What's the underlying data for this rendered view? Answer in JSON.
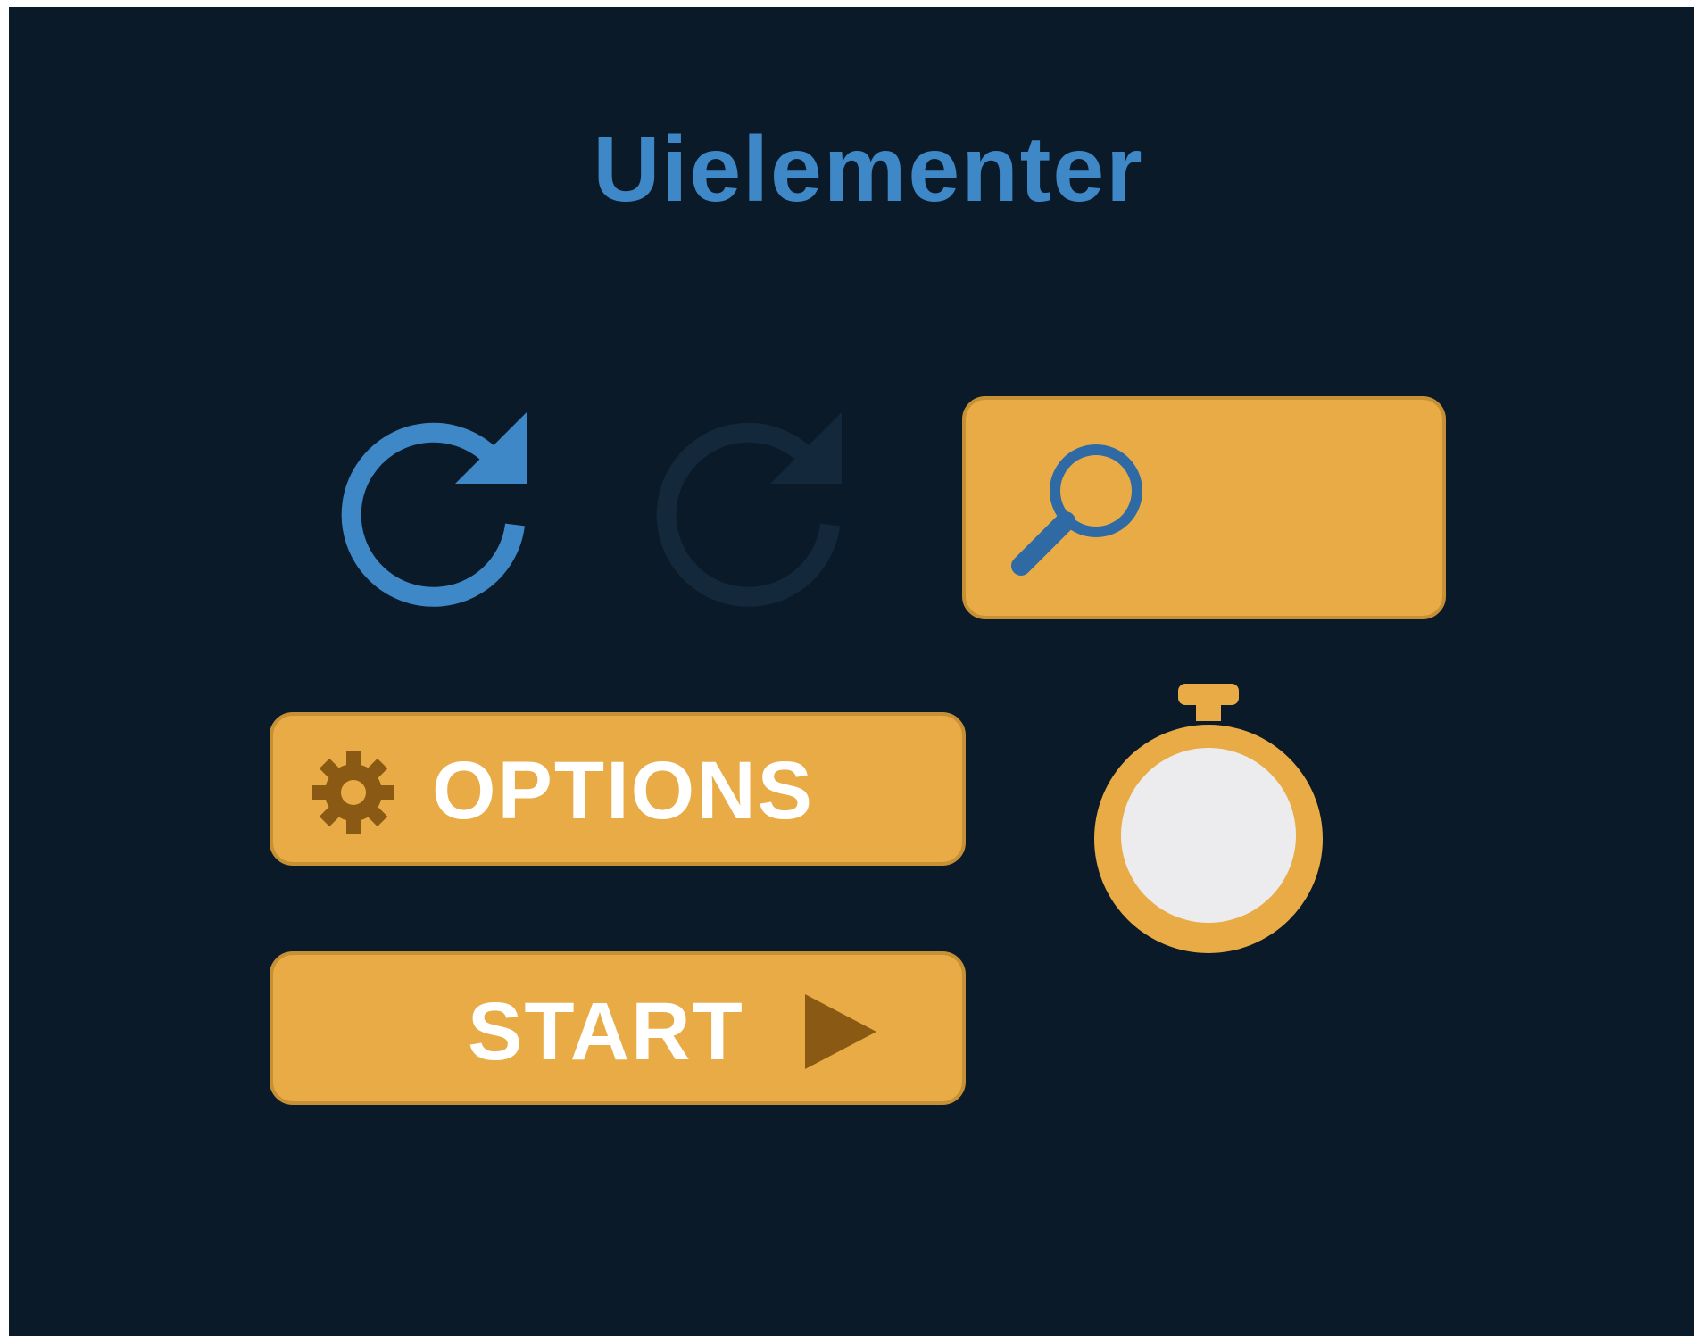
{
  "title": "Uielementer",
  "icons": {
    "refresh_active": "refresh-icon",
    "refresh_disabled": "refresh-icon-disabled",
    "search": "search-icon",
    "gear": "gear-icon",
    "play": "play-icon",
    "stopwatch": "stopwatch-icon"
  },
  "search": {
    "value": "",
    "placeholder": ""
  },
  "buttons": {
    "options_label": "OPTIONS",
    "start_label": "START"
  },
  "colors": {
    "background": "#0b1a28",
    "accent_blue": "#3f88c8",
    "button_orange": "#e8ab46",
    "button_border": "#c69035",
    "icon_brown": "#8a5a14",
    "disabled_icon": "#13283a",
    "stopwatch_face": "#ecebee"
  }
}
